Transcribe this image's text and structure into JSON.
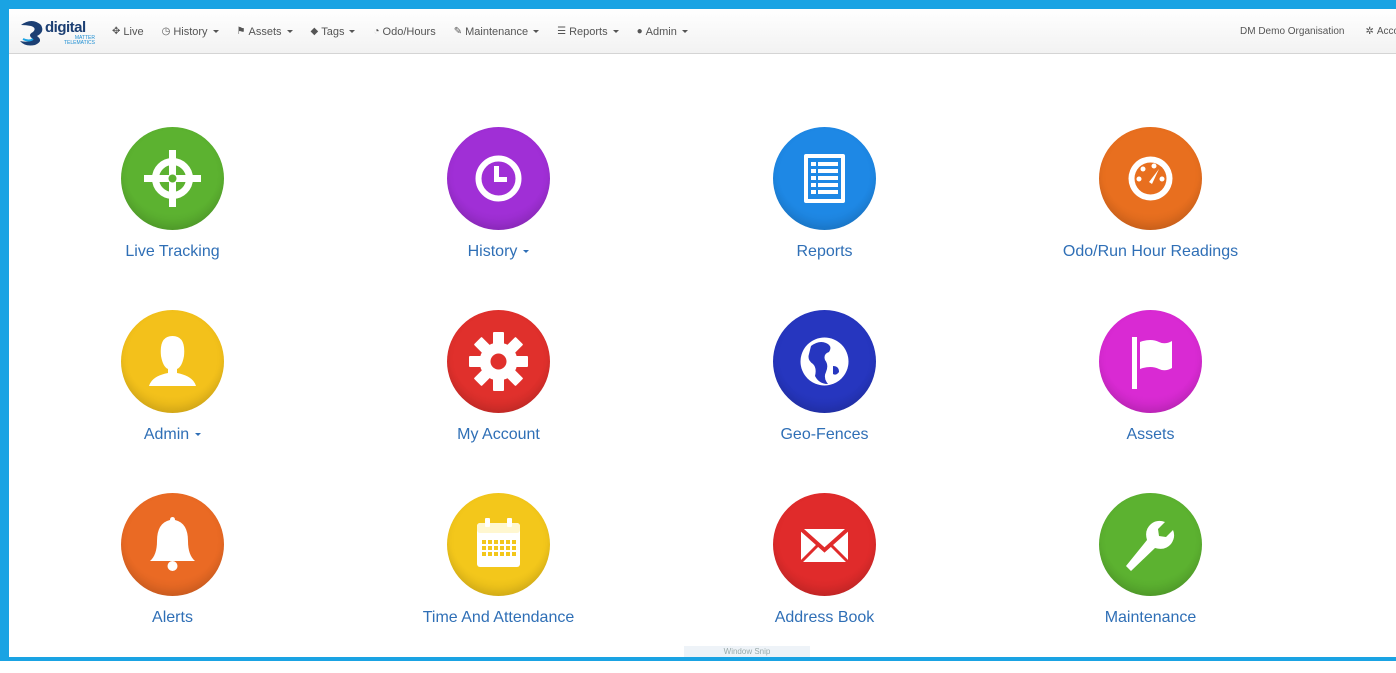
{
  "navbar": {
    "brand": {
      "name": "digital",
      "sub_line1": "MATTER",
      "sub_line2": "TELEMATICS"
    },
    "items": [
      {
        "label": "Live",
        "icon": "crosshair-icon",
        "glyph": "✥",
        "dropdown": false
      },
      {
        "label": "History",
        "icon": "clock-icon",
        "glyph": "◷",
        "dropdown": true
      },
      {
        "label": "Assets",
        "icon": "flag-icon",
        "glyph": "⚑",
        "dropdown": true
      },
      {
        "label": "Tags",
        "icon": "tag-icon",
        "glyph": "◆",
        "dropdown": true
      },
      {
        "label": "Odo/Hours",
        "icon": "dashboard-icon",
        "glyph": "◔",
        "dropdown": false
      },
      {
        "label": "Maintenance",
        "icon": "wrench-icon",
        "glyph": "✎",
        "dropdown": true
      },
      {
        "label": "Reports",
        "icon": "list-icon",
        "glyph": "☰",
        "dropdown": true
      },
      {
        "label": "Admin",
        "icon": "user-icon",
        "glyph": "●",
        "dropdown": true
      }
    ],
    "organisation": "DM Demo Organisation",
    "account_label": "Account",
    "account_icon": "gear-icon",
    "account_glyph": "✲"
  },
  "tiles": [
    {
      "label": "Live Tracking",
      "icon": "crosshair-icon",
      "color": "#5cb230",
      "dropdown": false
    },
    {
      "label": "History",
      "icon": "clock-icon",
      "color": "#a02fd6",
      "dropdown": true
    },
    {
      "label": "Reports",
      "icon": "list-icon",
      "color": "#1e88e5",
      "dropdown": false
    },
    {
      "label": "Odo/Run Hour Readings",
      "icon": "dashboard-icon",
      "color": "#e86f1f",
      "dropdown": false
    },
    {
      "label": "Admin",
      "icon": "user-icon",
      "color": "#f3c11b",
      "dropdown": true
    },
    {
      "label": "My Account",
      "icon": "gear-icon",
      "color": "#e0302c",
      "dropdown": false
    },
    {
      "label": "Geo-Fences",
      "icon": "globe-icon",
      "color": "#2636bf",
      "dropdown": false
    },
    {
      "label": "Assets",
      "icon": "flag-icon",
      "color": "#d92ad3",
      "dropdown": false
    },
    {
      "label": "Alerts",
      "icon": "bell-icon",
      "color": "#ea6a24",
      "dropdown": false
    },
    {
      "label": "Time And Attendance",
      "icon": "calendar-icon",
      "color": "#f3c71b",
      "dropdown": false
    },
    {
      "label": "Address Book",
      "icon": "envelope-icon",
      "color": "#e02b2b",
      "dropdown": false
    },
    {
      "label": "Maintenance",
      "icon": "wrench-icon",
      "color": "#5cb230",
      "dropdown": false
    }
  ],
  "taskbar_hint": "Window Snip"
}
